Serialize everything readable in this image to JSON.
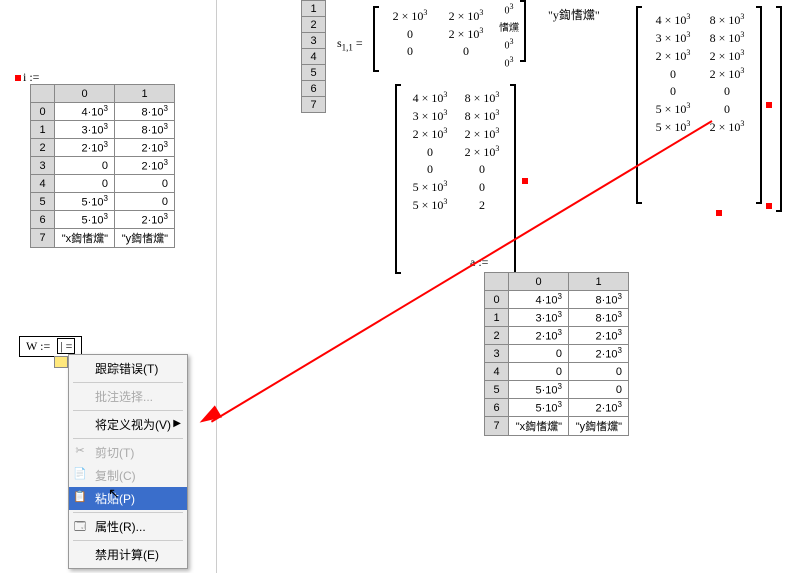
{
  "assign_left": {
    "text": "i :=",
    "red": true
  },
  "table_left": {
    "cols": [
      "0",
      "1"
    ],
    "rows": [
      [
        "0",
        "4·10³",
        "8·10³"
      ],
      [
        "1",
        "3·10³",
        "8·10³"
      ],
      [
        "2",
        "2·10³",
        "2·10³"
      ],
      [
        "3",
        "0",
        "2·10³"
      ],
      [
        "4",
        "0",
        "0"
      ],
      [
        "5",
        "5·10³",
        "0"
      ],
      [
        "6",
        "5·10³",
        "2·10³"
      ],
      [
        "7",
        "\"x鍧愭爣\"",
        "\"y鍧愭爣\""
      ]
    ]
  },
  "small_table": {
    "rows": [
      "1",
      "2",
      "3",
      "4",
      "5",
      "6",
      "7"
    ]
  },
  "s_label": "s₁,₁ =",
  "matrix_top": {
    "rows": [
      [
        "2 × 10³",
        "2 × 10³"
      ],
      [
        "0",
        "2 × 10³"
      ],
      [
        "0",
        "0"
      ]
    ]
  },
  "side_col": [
    "0³",
    "愭爣",
    "0³",
    "0³"
  ],
  "y_label": "\"y鍧愭爣\"",
  "matrix_mid": {
    "rows": [
      [
        "4 × 10³",
        "8 × 10³"
      ],
      [
        "3 × 10³",
        "8 × 10³"
      ],
      [
        "2 × 10³",
        "2 × 10³"
      ],
      [
        "0",
        "2 × 10³"
      ],
      [
        "0",
        "0"
      ],
      [
        "5 × 10³",
        "0"
      ],
      [
        "5 × 10³",
        "2"
      ]
    ]
  },
  "a_label": "a :=",
  "matrix_right": {
    "rows": [
      [
        "4 × 10³",
        "8 × 10³"
      ],
      [
        "3 × 10³",
        "8 × 10³"
      ],
      [
        "2 × 10³",
        "2 × 10³"
      ],
      [
        "0",
        "2 × 10³"
      ],
      [
        "0",
        "0"
      ],
      [
        "5 × 10³",
        "0"
      ],
      [
        "5 × 10³",
        "2 × 10³"
      ]
    ]
  },
  "table_right": {
    "cols": [
      "0",
      "1"
    ],
    "rows": [
      [
        "0",
        "4·10³",
        "8·10³"
      ],
      [
        "1",
        "3·10³",
        "8·10³"
      ],
      [
        "2",
        "2·10³",
        "2·10³"
      ],
      [
        "3",
        "0",
        "2·10³"
      ],
      [
        "4",
        "0",
        "0"
      ],
      [
        "5",
        "5·10³",
        "0"
      ],
      [
        "6",
        "5·10³",
        "2·10³"
      ],
      [
        "7",
        "\"x鍧愭爣\"",
        "\"y鍧愭爣\""
      ]
    ]
  },
  "wbox": "W :=",
  "wbox_inner": "| =",
  "context_menu": {
    "items": [
      {
        "label": "跟踪错误(T)",
        "disabled": false
      },
      {
        "sep": true
      },
      {
        "label": "批注选择...",
        "disabled": true
      },
      {
        "sep": true
      },
      {
        "label": "将定义视为(V)",
        "submenu": true
      },
      {
        "sep": true
      },
      {
        "label": "剪切(T)",
        "icon": "✂",
        "disabled": true
      },
      {
        "label": "复制(C)",
        "icon": "📄",
        "disabled": true
      },
      {
        "label": "粘贴(P)",
        "icon": "📋",
        "selected": true
      },
      {
        "sep": true
      },
      {
        "label": "属性(R)...",
        "icon": "🗔"
      },
      {
        "sep": true
      },
      {
        "label": "禁用计算(E)"
      }
    ]
  },
  "chart_data": {
    "type": "table",
    "note": "Two identical 8-row x 2-col data tables and three bracketed matrices shown in a math worksheet",
    "table": {
      "columns": [
        "0",
        "1"
      ],
      "values": [
        [
          4000,
          8000
        ],
        [
          3000,
          8000
        ],
        [
          2000,
          2000
        ],
        [
          0,
          2000
        ],
        [
          0,
          0
        ],
        [
          5000,
          0
        ],
        [
          5000,
          2000
        ],
        [
          "x鍧愭爣",
          "y鍧愭爣"
        ]
      ]
    }
  }
}
